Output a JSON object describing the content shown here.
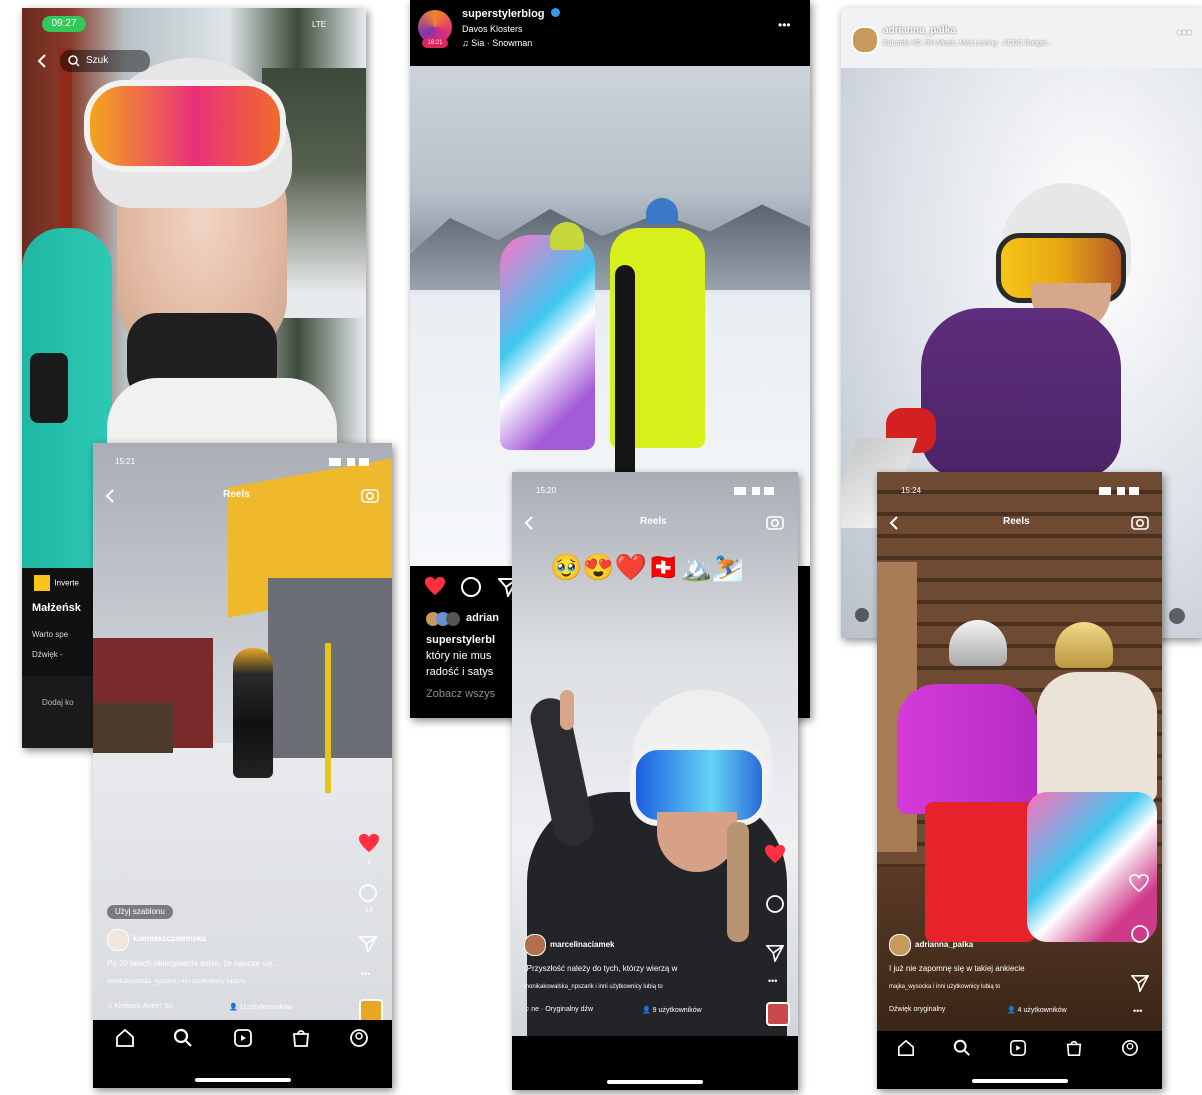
{
  "shot1": {
    "time": "09:27",
    "status_right": "LTE",
    "search_text": "Szuk",
    "label_inverte": "Inverte",
    "title": "Małżeńsk",
    "caption": "Warto spe",
    "sound": "Dźwięk -",
    "comment_placeholder": "Dodaj ko"
  },
  "shot2": {
    "time": "15:21",
    "header": "Reels",
    "use_template": "Użyj szablonu",
    "username": "kamilaszczawinska",
    "caption": "Po 20 latach obiecywania sobie, że nauczę się...",
    "tagged": "monikakowalska_npszarik i inni użytkownicy lubią to",
    "audio": "Kimberly Anne) Su",
    "people": "11 użytkowników",
    "like_count": "1",
    "comment_count": "14"
  },
  "shot3": {
    "username": "superstylerblog",
    "location": "Davos Klosters",
    "music": "Sia · Snowman",
    "avatar_badge": "16:21",
    "liked_by": "adrian",
    "caption_user": "superstylerbl",
    "caption_line2": "który nie mus",
    "caption_line3": "radość i satys",
    "view_all": "Zobacz wszys"
  },
  "shot4": {
    "time": "15:20",
    "header": "Reels",
    "emojis": "🥹😍❤️🇨🇭🏔️⛷️",
    "username": "marcelinaciamek",
    "caption": "„Przyszłość należy do tych, którzy wierzą w",
    "tagged": "monikakowalska_npszarik i inni użytkownicy lubią to",
    "audio": "ne · Oryginalny dźw",
    "people": "9 użytkowników"
  },
  "shot5": {
    "username": "adrianna_palka",
    "music_line": "Eduardo XD, RH Music, Matt Lowing · ACDC Boogie..."
  },
  "shot6": {
    "time": "15:24",
    "header": "Reels",
    "username": "adrianna_palka",
    "caption": "I już nie zapomnę się w takiej ankiecie",
    "tagged": "majka_wysocka i inni użytkownicy lubią to",
    "audio": "Dźwięk oryginalny",
    "people": "4 użytkowników"
  },
  "colors": {
    "like_red": "#ff3040",
    "instagram_blue": "#3897f0",
    "time_pill_green": "#34c759"
  }
}
